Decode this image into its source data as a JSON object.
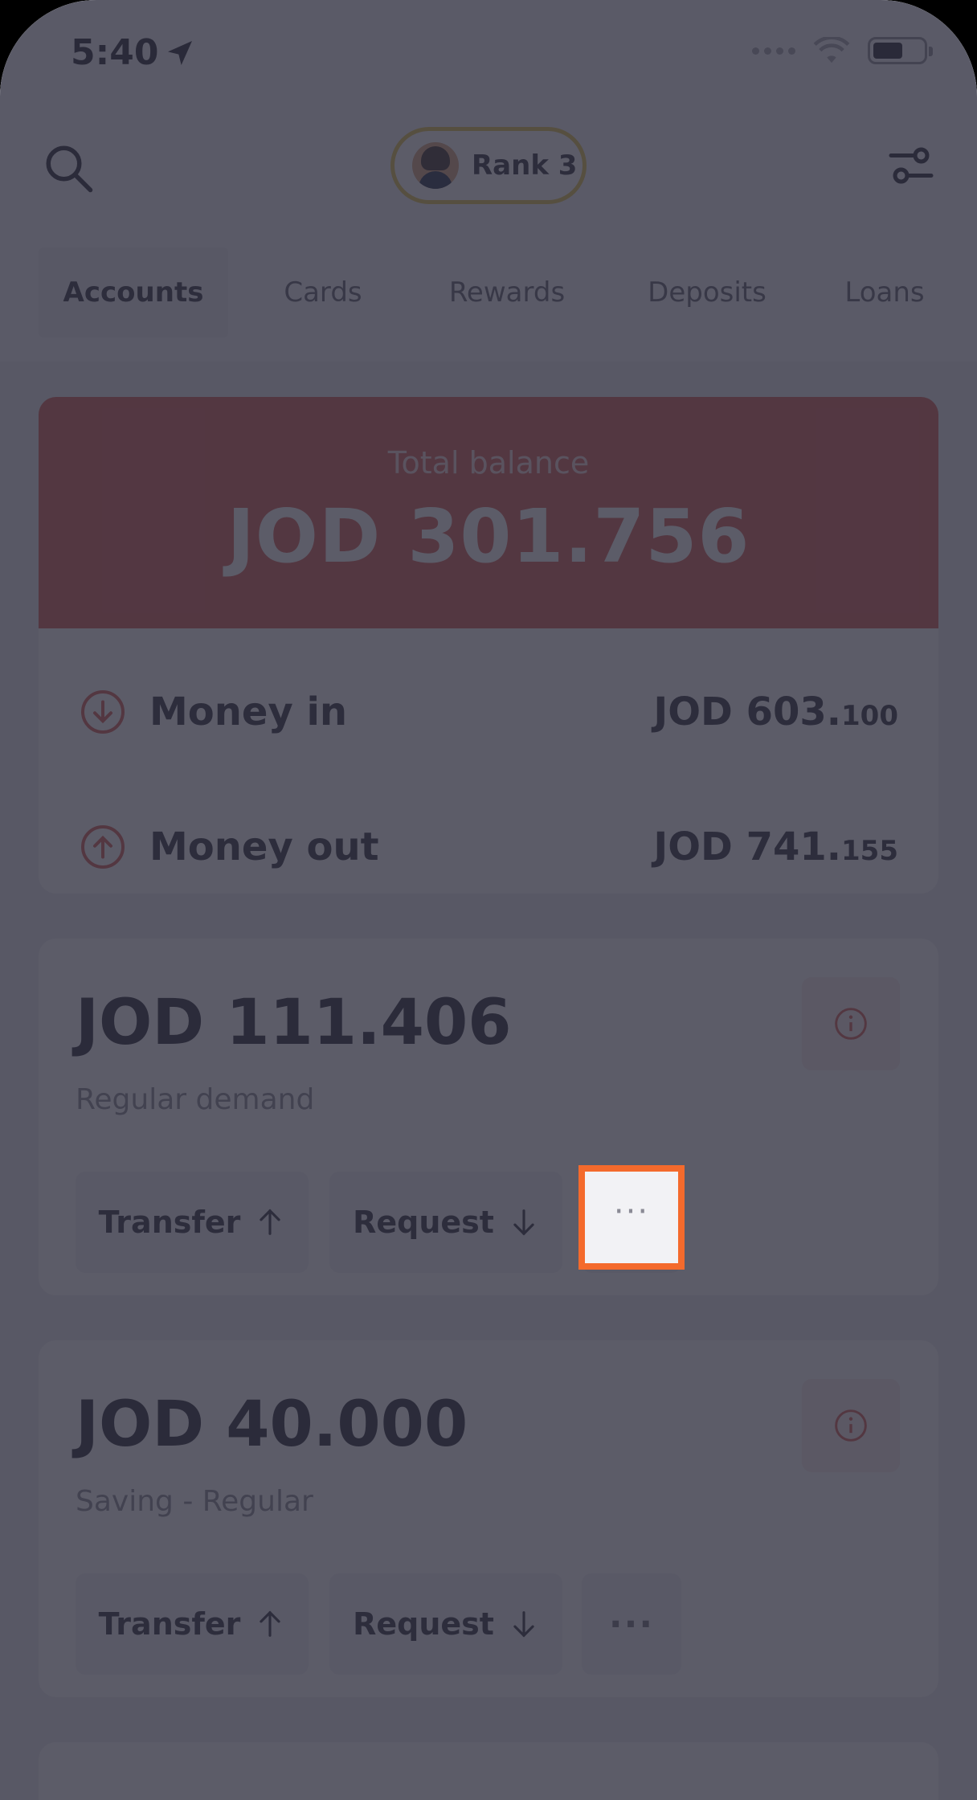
{
  "status_bar": {
    "time": "5:40"
  },
  "header": {
    "rank_label": "Rank 3"
  },
  "tabs": [
    {
      "label": "Accounts",
      "active": true
    },
    {
      "label": "Cards"
    },
    {
      "label": "Rewards"
    },
    {
      "label": "Deposits"
    },
    {
      "label": "Loans"
    }
  ],
  "balance": {
    "label": "Total balance",
    "value": "JOD 301.756"
  },
  "money_flow": {
    "in_label": "Money in",
    "in_main": "JOD 603.",
    "in_minor": "100",
    "out_label": "Money out",
    "out_main": "JOD 741.",
    "out_minor": "155"
  },
  "accounts": [
    {
      "amount": "JOD 111.406",
      "type": "Regular demand",
      "transfer_label": "Transfer",
      "request_label": "Request",
      "more_label": "···"
    },
    {
      "amount": "JOD 40.000",
      "type": "Saving - Regular",
      "transfer_label": "Transfer",
      "request_label": "Request",
      "more_label": "···"
    }
  ],
  "colors": {
    "accent": "#d5564e",
    "highlight": "#f46a2c",
    "overlay": "#2e2e3e"
  }
}
